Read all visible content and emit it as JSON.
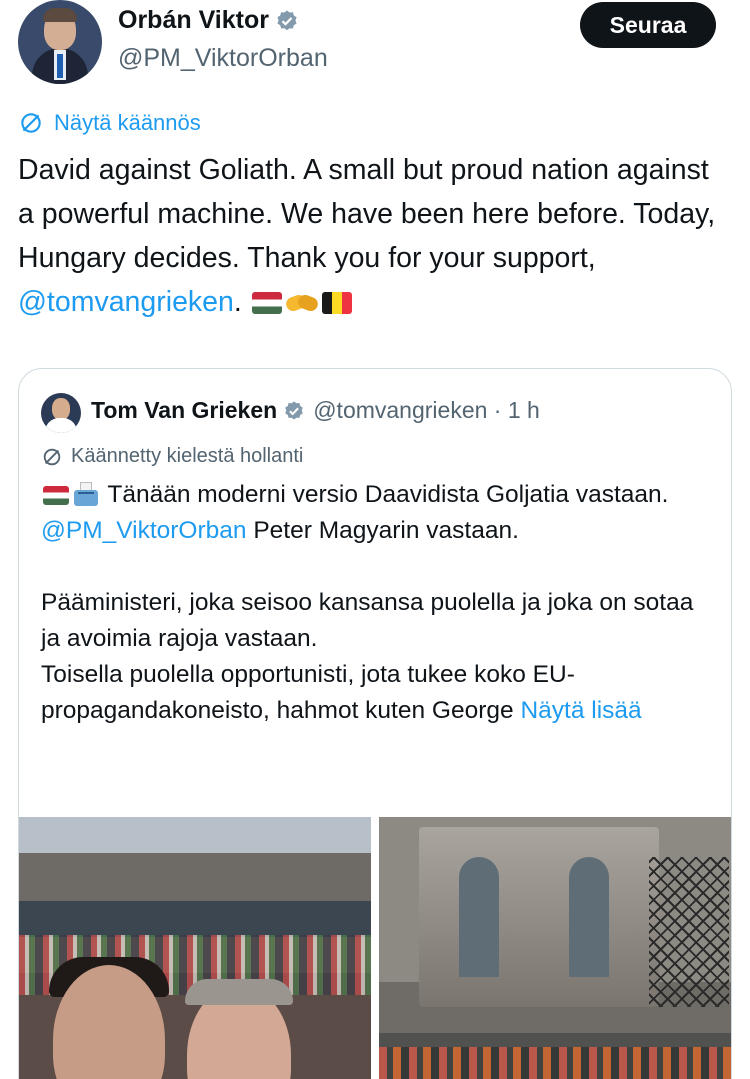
{
  "author": {
    "display_name": "Orbán Viktor",
    "handle": "@PM_ViktorOrban"
  },
  "follow_button": {
    "label": "Seuraa"
  },
  "translate_link": {
    "label": "Näytä käännös"
  },
  "tweet": {
    "text_main": "David against Goliath. A small but proud nation against a powerful machine. We have been here before. Today, Hungary decides. Thank you for your support, ",
    "mention": "@tomvangrieken",
    "text_end": "."
  },
  "quote": {
    "display_name": "Tom Van Grieken",
    "handle_time": "@tomvangrieken · 1 h",
    "translated_note": "Käännetty kielestä hollanti",
    "text_line1": " Tänään moderni versio Daavidista Goljatia vastaan. ",
    "mention": "@PM_ViktorOrban",
    "text_after_mention": " Peter Magyarin vastaan.\n\nPääministeri, joka seisoo kansansa puolella ja joka on sotaa ja avoimia rajoja vastaan.\nToisella puolella opportunisti, jota tukee koko EU-propagandakoneisto, hahmot kuten George ",
    "show_more": "Näytä lisää"
  },
  "colors": {
    "link": "#1d9bf0",
    "secondary_text": "#536471",
    "primary_text": "#0f1419",
    "verified": "#829aab"
  },
  "icons": [
    "verified-badge-icon",
    "translate-icon",
    "hungary-flag-emoji",
    "handshake-emoji",
    "belgium-flag-emoji",
    "ballot-box-emoji"
  ]
}
